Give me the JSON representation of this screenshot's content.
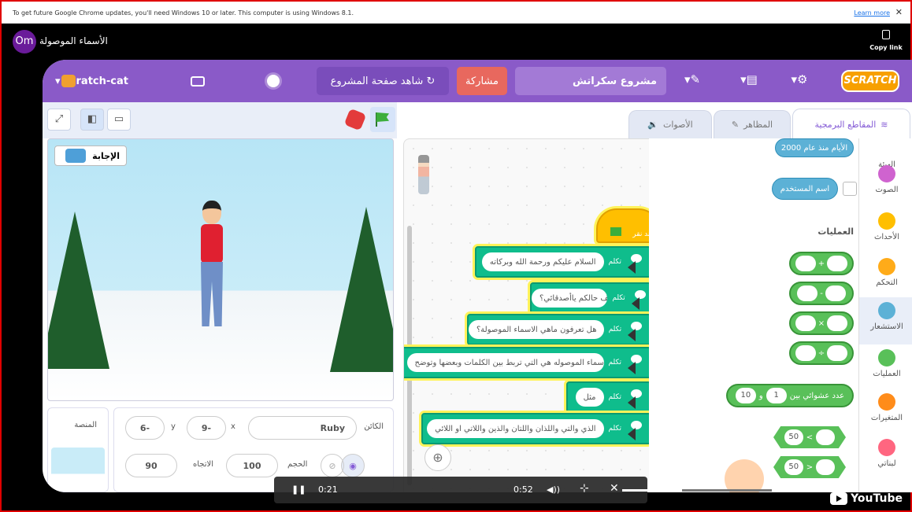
{
  "chrome_notice": {
    "message": "To get future Google Chrome updates, you'll need Windows 10 or later. This computer is using Windows 8.1.",
    "learn_more": "Learn more",
    "close": "✕"
  },
  "youtube": {
    "avatar": "Om",
    "title": "الأسماء الموصولة",
    "copy_link": "Copy link",
    "logo": "YouTube"
  },
  "menubar": {
    "logo": "SCRATCH",
    "project_title": "مشروع سكراتش",
    "share": "مشاركة",
    "see_project": "شاهد صفحة المشروع",
    "username": "scratch-cat"
  },
  "stage": {
    "answer_label": "الإجابة"
  },
  "sprite_info": {
    "sprite_label": "الكائن",
    "sprite_name": "Ruby",
    "x_label": "x",
    "x_value": "-9",
    "y_label": "y",
    "y_value": "-6",
    "size_label": "الحجم",
    "size_value": "100",
    "direction_label": "الاتجاه",
    "direction_value": "90",
    "stage_label": "المنصة"
  },
  "tabs": {
    "code": "المقاطع البرمجية",
    "costumes": "المظاهر",
    "sounds": "الأصوات"
  },
  "script": {
    "hat_label": "عند نقر",
    "say_keyword": "تكلم",
    "messages": [
      "السلام عليكم ورحمة الله وبركاته",
      "كيف حالكم ياأصدقائي؟",
      "هل تعرفون ماهي الاسماء الموصولة؟",
      "الاسماء الموصوله هي التي تربط بين الكلمات وبعضها وتوضح",
      "مثل",
      "الذي والتي واللذان واللتان والذين واللاتي او اللائي"
    ]
  },
  "palette": {
    "days_since": "الأيام منذ عام 2000",
    "username": "اسم المستخدم",
    "operators_heading": "العمليات",
    "ops": [
      "+",
      "-",
      "×",
      "÷"
    ],
    "random_label": "عدد عشوائي بين",
    "random_and": "و",
    "random_from": "1",
    "random_to": "10",
    "compare_value": "50",
    "lt": "<",
    "gt": ">"
  },
  "categories": [
    {
      "label": "الهيئة",
      "color": "#9966ff"
    },
    {
      "label": "الصوت",
      "color": "#cf63cf"
    },
    {
      "label": "الأحداث",
      "color": "#ffbf00"
    },
    {
      "label": "التحكم",
      "color": "#ffab19"
    },
    {
      "label": "الاستشعار",
      "color": "#5cb1d6"
    },
    {
      "label": "العمليات",
      "color": "#59c059"
    },
    {
      "label": "المتغيرات",
      "color": "#ff8c1a"
    },
    {
      "label": "لبناتي",
      "color": "#ff6680"
    }
  ],
  "player": {
    "current": "0:21",
    "duration": "0:52",
    "progress": 0.4
  }
}
